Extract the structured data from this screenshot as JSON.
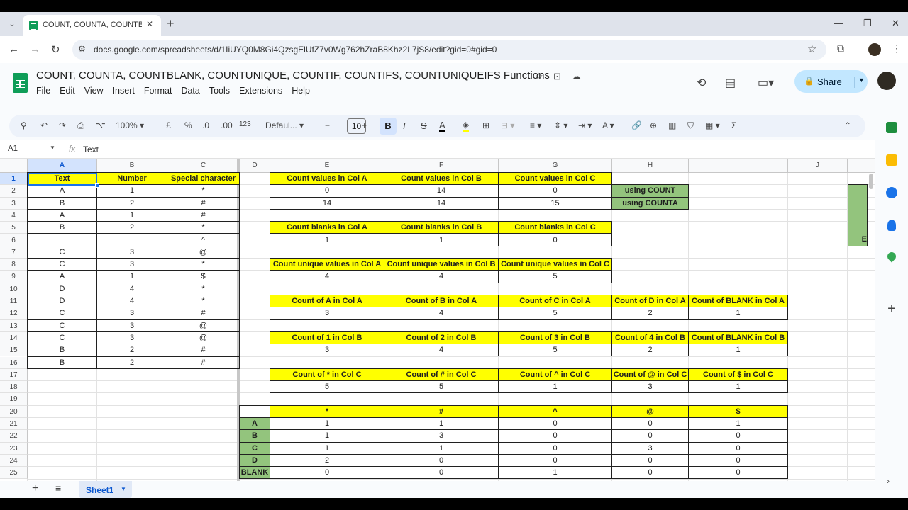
{
  "browser": {
    "tab_title": "COUNT, COUNTA, COUNTBLAN",
    "url": "docs.google.com/spreadsheets/d/1IiUYQ0M8Gi4QzsgElUfZ7v0Wg762hZraB8Khz2L7jS8/edit?gid=0#gid=0"
  },
  "doc": {
    "title": "COUNT, COUNTA, COUNTBLANK, COUNTUNIQUE, COUNTIF, COUNTIFS, COUNTUNIQUEIFS Functions",
    "menu": [
      "File",
      "Edit",
      "View",
      "Insert",
      "Format",
      "Data",
      "Tools",
      "Extensions",
      "Help"
    ],
    "share_label": "Share"
  },
  "toolbar": {
    "zoom": "100%",
    "currency": "£",
    "percent": "%",
    "dec_decrease": ".0",
    "dec_increase": ".00",
    "number_format": "123",
    "font": "Defaul...",
    "font_size": "10",
    "bold": "B",
    "italic": "I",
    "strike": "S",
    "text_color": "A"
  },
  "formula_bar": {
    "name_box": "A1",
    "fx": "fx",
    "value": "Text"
  },
  "grid": {
    "columns": [
      "A",
      "B",
      "C",
      "D",
      "E",
      "F",
      "G",
      "H",
      "I",
      "J"
    ],
    "rows": [
      "1",
      "2",
      "3",
      "4",
      "5",
      "6",
      "7",
      "8",
      "9",
      "10",
      "11",
      "12",
      "13",
      "14",
      "15",
      "16",
      "17",
      "18",
      "19",
      "20",
      "21",
      "22",
      "23",
      "24",
      "25"
    ],
    "data_table": {
      "headers": [
        "Text",
        "Number",
        "Special character"
      ],
      "rows": [
        [
          "A",
          "1",
          "*"
        ],
        [
          "B",
          "2",
          "#"
        ],
        [
          "A",
          "1",
          "#"
        ],
        [
          "B",
          "2",
          "*"
        ],
        [
          "",
          "",
          "^"
        ],
        [
          "C",
          "3",
          "@"
        ],
        [
          "C",
          "3",
          "*"
        ],
        [
          "A",
          "1",
          "$"
        ],
        [
          "D",
          "4",
          "*"
        ],
        [
          "D",
          "4",
          "*"
        ],
        [
          "C",
          "3",
          "#"
        ],
        [
          "C",
          "3",
          "@"
        ],
        [
          "C",
          "3",
          "@"
        ],
        [
          "B",
          "2",
          "#"
        ],
        [
          "B",
          "2",
          "#"
        ]
      ]
    },
    "count_values": {
      "headers": [
        "Count values in Col A",
        "Count values in Col B",
        "Count values in Col C"
      ],
      "rows": [
        [
          "0",
          "14",
          "0"
        ],
        [
          "14",
          "14",
          "15"
        ]
      ],
      "labels": [
        "using COUNT",
        "using COUNTA"
      ]
    },
    "count_blanks": {
      "headers": [
        "Count blanks in Col A",
        "Count blanks in Col B",
        "Count blanks in Col C"
      ],
      "values": [
        "1",
        "1",
        "0"
      ]
    },
    "count_unique": {
      "headers": [
        "Count unique values in Col A",
        "Count unique values in Col B",
        "Count unique values in Col C"
      ],
      "values": [
        "4",
        "4",
        "5"
      ]
    },
    "count_col_a": {
      "headers": [
        "Count of A in Col A",
        "Count of B in Col A",
        "Count of C in Col A",
        "Count of D in Col A",
        "Count of BLANK in Col A"
      ],
      "values": [
        "3",
        "4",
        "5",
        "2",
        "1"
      ]
    },
    "count_col_b": {
      "headers": [
        "Count of 1 in Col B",
        "Count of 2 in Col B",
        "Count of 3 in Col B",
        "Count of 4 in Col B",
        "Count of BLANK in Col B"
      ],
      "values": [
        "3",
        "4",
        "5",
        "2",
        "1"
      ]
    },
    "count_col_c": {
      "headers": [
        "Count of * in Col C",
        "Count of # in Col C",
        "Count of ^ in Col C",
        "Count of @ in Col C",
        "Count of $ in Col C"
      ],
      "values": [
        "5",
        "5",
        "1",
        "3",
        "1"
      ]
    },
    "cross_table": {
      "headers": [
        "*",
        "#",
        "^",
        "@",
        "$"
      ],
      "row_labels": [
        "A",
        "B",
        "C",
        "D",
        "BLANK"
      ],
      "rows": [
        [
          "1",
          "1",
          "0",
          "0",
          "1"
        ],
        [
          "1",
          "3",
          "0",
          "0",
          "0"
        ],
        [
          "1",
          "1",
          "0",
          "3",
          "0"
        ],
        [
          "2",
          "0",
          "0",
          "0",
          "0"
        ],
        [
          "0",
          "0",
          "1",
          "0",
          "0"
        ]
      ]
    },
    "right_edge_letter": "E"
  },
  "sheet": {
    "tab_label": "Sheet1"
  }
}
